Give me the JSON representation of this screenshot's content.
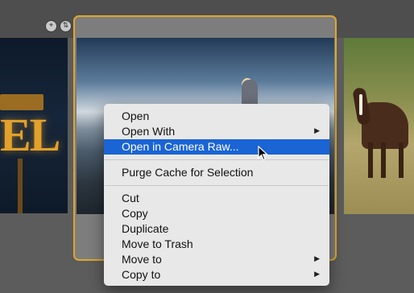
{
  "toolbar": {
    "icons": [
      "crop-icon",
      "sort-icon"
    ]
  },
  "thumbnails": {
    "left": {
      "sign_text": "EL"
    },
    "center": {
      "selected": true
    },
    "right": {}
  },
  "context_menu": {
    "open": "Open",
    "open_with": "Open With",
    "open_in_camera_raw": "Open in Camera Raw...",
    "purge_cache": "Purge Cache for Selection",
    "cut": "Cut",
    "copy": "Copy",
    "duplicate": "Duplicate",
    "move_to_trash": "Move to Trash",
    "move_to": "Move to",
    "copy_to": "Copy to",
    "submenu_arrow": "▶",
    "highlight_color": "#1a64d4"
  },
  "colors": {
    "selection_border": "#e0a72b",
    "background": "#5c5c5c"
  }
}
